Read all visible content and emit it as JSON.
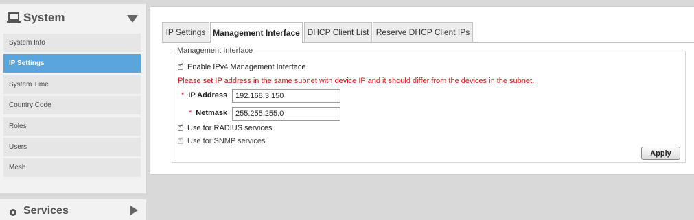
{
  "sidebar": {
    "title": "System",
    "title_icon": "laptop-icon",
    "items": [
      {
        "label": "System Info",
        "active": false
      },
      {
        "label": "IP Settings",
        "active": true
      },
      {
        "label": "System Time",
        "active": false
      },
      {
        "label": "Country Code",
        "active": false
      },
      {
        "label": "Roles",
        "active": false
      },
      {
        "label": "Users",
        "active": false
      },
      {
        "label": "Mesh",
        "active": false
      }
    ],
    "next_section": "Services"
  },
  "tabs": [
    {
      "label": "IP Settings",
      "active": false
    },
    {
      "label": "Management Interface",
      "active": true
    },
    {
      "label": "DHCP Client List",
      "active": false
    },
    {
      "label": "Reserve DHCP Client IPs",
      "active": false
    }
  ],
  "form": {
    "legend": "Management Interface",
    "enable_ipv4_label": "Enable IPv4 Management Interface",
    "enable_ipv4_checked": true,
    "warning": "Please set IP address in the same subnet with device IP and it should differ from the devices in the subnet.",
    "required_mark": "*",
    "ip_address_label": "IP Address",
    "ip_address_value": "192.168.3.150",
    "netmask_label": "Netmask",
    "netmask_value": "255.255.255.0",
    "radius_label": "Use for RADIUS services",
    "radius_checked": true,
    "snmp_label": "Use for SNMP services",
    "snmp_checked": true,
    "snmp_disabled": true,
    "apply_label": "Apply"
  },
  "colors": {
    "accent": "#5aa5dc",
    "warning": "#e0151b",
    "background": "#d9d9d9"
  }
}
